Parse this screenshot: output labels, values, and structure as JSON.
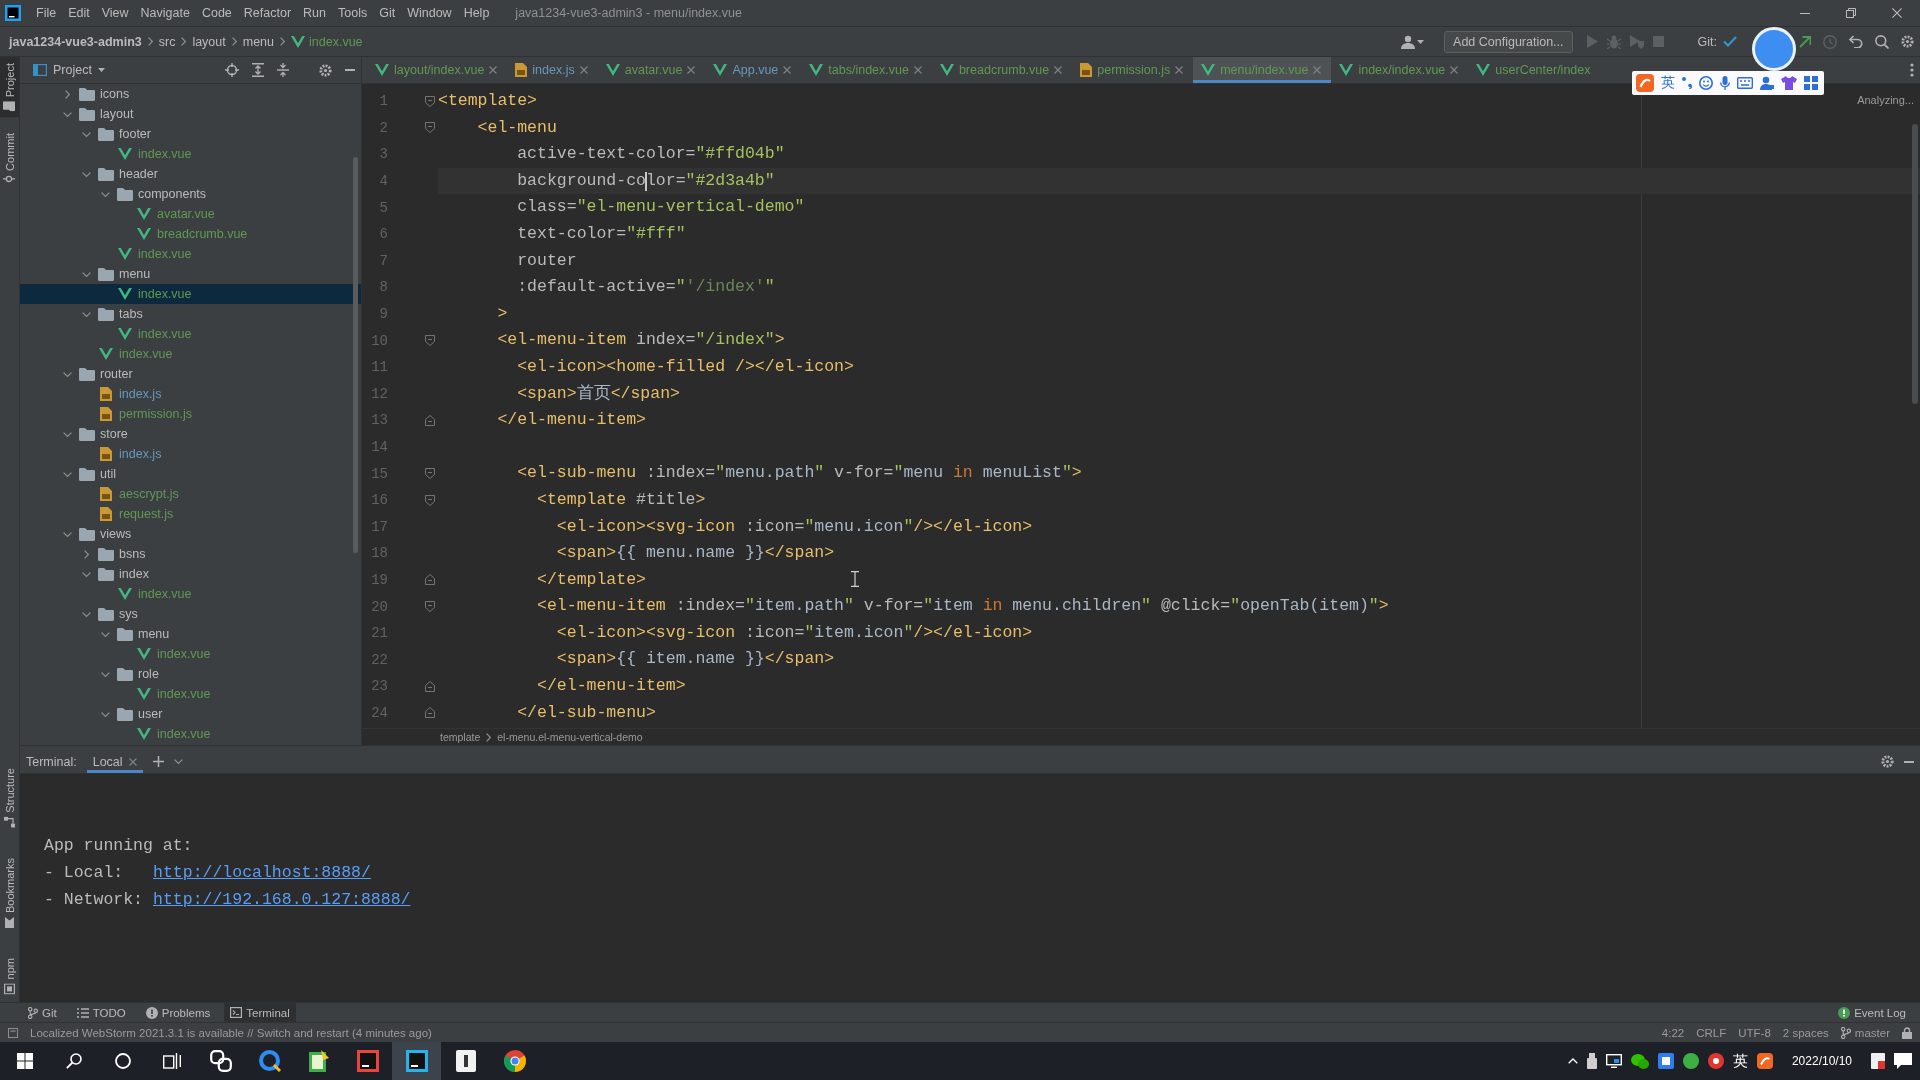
{
  "menu_bar": {
    "items": [
      "File",
      "Edit",
      "View",
      "Navigate",
      "Code",
      "Refactor",
      "Run",
      "Tools",
      "Git",
      "Window",
      "Help"
    ],
    "title": "java1234-vue3-admin3 - menu/index.vue"
  },
  "nav_bar": {
    "breadcrumb": [
      {
        "label": "java1234-vue3-admin3",
        "kind": "project"
      },
      {
        "label": "src",
        "kind": "folder"
      },
      {
        "label": "layout",
        "kind": "folder"
      },
      {
        "label": "menu",
        "kind": "folder"
      },
      {
        "label": "index.vue",
        "kind": "vue",
        "modified": false
      }
    ],
    "run_config": "Add Configuration...",
    "vcs_label": "Git:"
  },
  "side_strip": {
    "top": [
      {
        "label": "Project",
        "kind": "project",
        "selected": true
      },
      {
        "label": "Commit",
        "kind": "commit",
        "selected": false
      }
    ],
    "bottom": [
      {
        "label": "Structure",
        "kind": "structure"
      },
      {
        "label": "Bookmarks",
        "kind": "bookmarks"
      },
      {
        "label": "npm",
        "kind": "npm"
      }
    ]
  },
  "project_panel": {
    "title": "Project",
    "tree": [
      {
        "name": "icons",
        "kind": "folder",
        "expanded": false,
        "selected": false
      },
      {
        "name": "layout",
        "kind": "folder",
        "expanded": true,
        "selected": false,
        "children": [
          {
            "name": "footer",
            "kind": "folder",
            "expanded": true,
            "selected": false,
            "children": [
              {
                "name": "index.vue",
                "kind": "vue",
                "modified": false,
                "selected": false
              }
            ]
          },
          {
            "name": "header",
            "kind": "folder",
            "expanded": true,
            "selected": false,
            "children": [
              {
                "name": "components",
                "kind": "folder",
                "expanded": true,
                "selected": false,
                "children": [
                  {
                    "name": "avatar.vue",
                    "kind": "vue",
                    "modified": false,
                    "selected": false
                  },
                  {
                    "name": "breadcrumb.vue",
                    "kind": "vue",
                    "modified": false,
                    "selected": false
                  }
                ]
              },
              {
                "name": "index.vue",
                "kind": "vue",
                "modified": false,
                "selected": false
              }
            ]
          },
          {
            "name": "menu",
            "kind": "folder",
            "expanded": true,
            "selected": false,
            "children": [
              {
                "name": "index.vue",
                "kind": "vue",
                "modified": false,
                "selected": true
              }
            ]
          },
          {
            "name": "tabs",
            "kind": "folder",
            "expanded": true,
            "selected": false,
            "children": [
              {
                "name": "index.vue",
                "kind": "vue",
                "modified": false,
                "selected": false
              }
            ]
          },
          {
            "name": "index.vue",
            "kind": "vue",
            "modified": false,
            "selected": false
          }
        ]
      },
      {
        "name": "router",
        "kind": "folder",
        "expanded": true,
        "selected": false,
        "children": [
          {
            "name": "index.js",
            "kind": "js",
            "modified": true,
            "selected": false
          },
          {
            "name": "permission.js",
            "kind": "js",
            "modified": false,
            "selected": false
          }
        ]
      },
      {
        "name": "store",
        "kind": "folder",
        "expanded": true,
        "selected": false,
        "children": [
          {
            "name": "index.js",
            "kind": "js",
            "modified": true,
            "selected": false
          }
        ]
      },
      {
        "name": "util",
        "kind": "folder",
        "expanded": true,
        "selected": false,
        "children": [
          {
            "name": "aescrypt.js",
            "kind": "js",
            "modified": false,
            "selected": false
          },
          {
            "name": "request.js",
            "kind": "js",
            "modified": false,
            "selected": false
          }
        ]
      },
      {
        "name": "views",
        "kind": "folder",
        "expanded": true,
        "selected": false,
        "children": [
          {
            "name": "bsns",
            "kind": "folder",
            "expanded": false,
            "selected": false
          },
          {
            "name": "index",
            "kind": "folder",
            "expanded": true,
            "selected": false,
            "children": [
              {
                "name": "index.vue",
                "kind": "vue",
                "modified": false,
                "selected": false
              }
            ]
          },
          {
            "name": "sys",
            "kind": "folder",
            "expanded": true,
            "selected": false,
            "children": [
              {
                "name": "menu",
                "kind": "folder",
                "expanded": true,
                "selected": false,
                "children": [
                  {
                    "name": "index.vue",
                    "kind": "vue",
                    "modified": false,
                    "selected": false
                  }
                ]
              },
              {
                "name": "role",
                "kind": "folder",
                "expanded": true,
                "selected": false,
                "children": [
                  {
                    "name": "index.vue",
                    "kind": "vue",
                    "modified": false,
                    "selected": false
                  }
                ]
              },
              {
                "name": "user",
                "kind": "folder",
                "expanded": true,
                "selected": false,
                "children": [
                  {
                    "name": "index.vue",
                    "kind": "vue",
                    "modified": false,
                    "selected": false
                  }
                ]
              }
            ]
          }
        ]
      }
    ]
  },
  "editor": {
    "tabs": [
      {
        "label": "layout/index.vue",
        "kind": "vue",
        "modified": false,
        "selected": false,
        "closable": true
      },
      {
        "label": "index.js",
        "kind": "js",
        "modified": true,
        "selected": false,
        "closable": true
      },
      {
        "label": "avatar.vue",
        "kind": "vue",
        "modified": false,
        "selected": false,
        "closable": true
      },
      {
        "label": "App.vue",
        "kind": "vue",
        "modified": true,
        "selected": false,
        "closable": true
      },
      {
        "label": "tabs/index.vue",
        "kind": "vue",
        "modified": false,
        "selected": false,
        "closable": true
      },
      {
        "label": "breadcrumb.vue",
        "kind": "vue",
        "modified": false,
        "selected": false,
        "closable": true
      },
      {
        "label": "permission.js",
        "kind": "js",
        "modified": false,
        "selected": false,
        "closable": true
      },
      {
        "label": "menu/index.vue",
        "kind": "vue",
        "modified": false,
        "selected": true,
        "closable": true
      },
      {
        "label": "index/index.vue",
        "kind": "vue",
        "modified": false,
        "selected": false,
        "closable": true
      },
      {
        "label": "userCenter/index",
        "kind": "vue",
        "modified": false,
        "selected": false,
        "closable": false
      }
    ],
    "lines": [
      {
        "number": "1",
        "kind": "foldstart",
        "tokens": [
          {
            "kind": "tag",
            "text": "<template>"
          }
        ]
      },
      {
        "number": "2",
        "kind": "foldstart",
        "tokens": [
          {
            "kind": "tag",
            "text": "    <el-menu"
          }
        ]
      },
      {
        "number": "3",
        "kind": "plain",
        "tokens": [
          {
            "kind": "attr",
            "text": "        active-text-color="
          },
          {
            "kind": "value",
            "text": "\"#ffd04b\""
          }
        ]
      },
      {
        "number": "4",
        "kind": "plain",
        "tokens": [
          {
            "kind": "attr",
            "text": "        background-co"
          },
          {
            "kind": "caret"
          },
          {
            "kind": "attr",
            "text": "lor="
          },
          {
            "kind": "value",
            "text": "\"#2d3a4b\""
          }
        ]
      },
      {
        "number": "5",
        "kind": "plain",
        "tokens": [
          {
            "kind": "attr",
            "text": "        class="
          },
          {
            "kind": "value",
            "text": "\"el-menu-vertical-demo\""
          }
        ]
      },
      {
        "number": "6",
        "kind": "plain",
        "tokens": [
          {
            "kind": "attr",
            "text": "        text-color="
          },
          {
            "kind": "value",
            "text": "\"#fff\""
          }
        ]
      },
      {
        "number": "7",
        "kind": "plain",
        "tokens": [
          {
            "kind": "attr",
            "text": "        router"
          }
        ]
      },
      {
        "number": "8",
        "kind": "plain",
        "tokens": [
          {
            "kind": "attr",
            "text": "        :default-active="
          },
          {
            "kind": "value",
            "text": "\""
          },
          {
            "kind": "string",
            "text": "'/index'"
          },
          {
            "kind": "value",
            "text": "\""
          }
        ]
      },
      {
        "number": "9",
        "kind": "plain",
        "tokens": [
          {
            "kind": "tag",
            "text": "      >"
          }
        ]
      },
      {
        "number": "10",
        "kind": "foldstart",
        "tokens": [
          {
            "kind": "tag",
            "text": "      <el-menu-item"
          },
          {
            "kind": "attr",
            "text": " index="
          },
          {
            "kind": "value",
            "text": "\"/index\""
          },
          {
            "kind": "tag",
            "text": ">"
          }
        ]
      },
      {
        "number": "11",
        "kind": "plain",
        "tokens": [
          {
            "kind": "tag",
            "text": "        <el-icon><home-filled /></el-icon>"
          }
        ]
      },
      {
        "number": "12",
        "kind": "plain",
        "tokens": [
          {
            "kind": "tag",
            "text": "        <span>"
          },
          {
            "kind": "text",
            "text": "首页"
          },
          {
            "kind": "tag",
            "text": "</span>"
          }
        ]
      },
      {
        "number": "13",
        "kind": "foldend",
        "tokens": [
          {
            "kind": "tag",
            "text": "      </el-menu-item>"
          }
        ]
      },
      {
        "number": "14",
        "kind": "plain"
      },
      {
        "number": "15",
        "kind": "foldstart",
        "tokens": [
          {
            "kind": "tag",
            "text": "        <el-sub-menu"
          },
          {
            "kind": "attr",
            "text": " :index="
          },
          {
            "kind": "value",
            "text": "\""
          },
          {
            "kind": "expr",
            "text": "menu.path"
          },
          {
            "kind": "value",
            "text": "\""
          },
          {
            "kind": "attr",
            "text": " v-for="
          },
          {
            "kind": "value",
            "text": "\""
          },
          {
            "kind": "expr",
            "text": "menu "
          },
          {
            "kind": "keyword",
            "text": "in"
          },
          {
            "kind": "expr",
            "text": " menuList"
          },
          {
            "kind": "value",
            "text": "\""
          },
          {
            "kind": "tag",
            "text": ">"
          }
        ]
      },
      {
        "number": "16",
        "kind": "foldstart",
        "tokens": [
          {
            "kind": "tag",
            "text": "          <template "
          },
          {
            "kind": "attr",
            "text": "#title"
          },
          {
            "kind": "tag",
            "text": ">"
          }
        ]
      },
      {
        "number": "17",
        "kind": "plain",
        "tokens": [
          {
            "kind": "tag",
            "text": "            <el-icon><svg-icon"
          },
          {
            "kind": "attr",
            "text": " :icon="
          },
          {
            "kind": "value",
            "text": "\""
          },
          {
            "kind": "expr",
            "text": "menu.icon"
          },
          {
            "kind": "value",
            "text": "\""
          },
          {
            "kind": "tag",
            "text": "/></el-icon>"
          }
        ]
      },
      {
        "number": "18",
        "kind": "plain",
        "tokens": [
          {
            "kind": "tag",
            "text": "            <span>"
          },
          {
            "kind": "expr",
            "text": "{{ menu.name }}"
          },
          {
            "kind": "tag",
            "text": "</span>"
          }
        ]
      },
      {
        "number": "19",
        "kind": "foldend",
        "tokens": [
          {
            "kind": "tag",
            "text": "          </template>"
          }
        ]
      },
      {
        "number": "20",
        "kind": "foldstart",
        "tokens": [
          {
            "kind": "tag",
            "text": "          <el-menu-item"
          },
          {
            "kind": "attr",
            "text": " :index="
          },
          {
            "kind": "value",
            "text": "\""
          },
          {
            "kind": "expr",
            "text": "item.path"
          },
          {
            "kind": "value",
            "text": "\""
          },
          {
            "kind": "attr",
            "text": " v-for="
          },
          {
            "kind": "value",
            "text": "\""
          },
          {
            "kind": "expr",
            "text": "item "
          },
          {
            "kind": "keyword",
            "text": "in"
          },
          {
            "kind": "expr",
            "text": " menu.children"
          },
          {
            "kind": "value",
            "text": "\""
          },
          {
            "kind": "attr",
            "text": " @click="
          },
          {
            "kind": "value",
            "text": "\""
          },
          {
            "kind": "expr",
            "text": "openTab(item)"
          },
          {
            "kind": "value",
            "text": "\""
          },
          {
            "kind": "tag",
            "text": ">"
          }
        ]
      },
      {
        "number": "21",
        "kind": "plain",
        "tokens": [
          {
            "kind": "tag",
            "text": "            <el-icon><svg-icon"
          },
          {
            "kind": "attr",
            "text": " :icon="
          },
          {
            "kind": "value",
            "text": "\""
          },
          {
            "kind": "expr",
            "text": "item.icon"
          },
          {
            "kind": "value",
            "text": "\""
          },
          {
            "kind": "tag",
            "text": "/></el-icon>"
          }
        ]
      },
      {
        "number": "22",
        "kind": "plain",
        "tokens": [
          {
            "kind": "tag",
            "text": "            <span>"
          },
          {
            "kind": "expr",
            "text": "{{ item.name }}"
          },
          {
            "kind": "tag",
            "text": "</span>"
          }
        ]
      },
      {
        "number": "23",
        "kind": "foldend",
        "tokens": [
          {
            "kind": "tag",
            "text": "          </el-menu-item>"
          }
        ]
      },
      {
        "number": "24",
        "kind": "foldend",
        "tokens": [
          {
            "kind": "tag",
            "text": "        </el-sub-menu>"
          }
        ]
      }
    ],
    "status": "Analyzing...",
    "breadcrumb": [
      "template",
      "el-menu.el-menu-vertical-demo"
    ]
  },
  "ime_toolbar": {
    "mode": "英"
  },
  "terminal": {
    "title": "Terminal:",
    "tabs": [
      {
        "label": "Local",
        "selected": true
      }
    ],
    "lines": [
      {
        "kind": "plain",
        "text": "App running at:"
      },
      {
        "kind": "link",
        "label": "- Local:",
        "url": "http://localhost:8888/"
      },
      {
        "kind": "link",
        "label": "- Network:",
        "url": "http://192.168.0.127:8888/"
      }
    ]
  },
  "tool_bar": {
    "items": [
      {
        "label": "Git",
        "kind": "git",
        "selected": false
      },
      {
        "label": "TODO",
        "kind": "todo",
        "selected": false
      },
      {
        "label": "Problems",
        "kind": "problems",
        "selected": false
      },
      {
        "label": "Terminal",
        "kind": "terminal",
        "selected": true
      }
    ],
    "event_log": "Event Log"
  },
  "status_bar": {
    "message": "Localized WebStorm 2021.3.1 is available // Switch and restart (4 minutes ago)",
    "items": [
      "4:22",
      "CRLF",
      "UTF-8",
      "2 spaces"
    ],
    "branch": "master"
  },
  "taskbar": {
    "apps": [
      {
        "kind": "knot",
        "selected": false
      },
      {
        "kind": "ring",
        "selected": false
      },
      {
        "kind": "notepad",
        "selected": false
      },
      {
        "kind": "redide",
        "selected": false
      },
      {
        "kind": "blueide",
        "selected": true
      },
      {
        "kind": "document",
        "selected": false
      },
      {
        "kind": "globe",
        "selected": false
      }
    ],
    "ime": "英",
    "date": "2022/10/10"
  }
}
